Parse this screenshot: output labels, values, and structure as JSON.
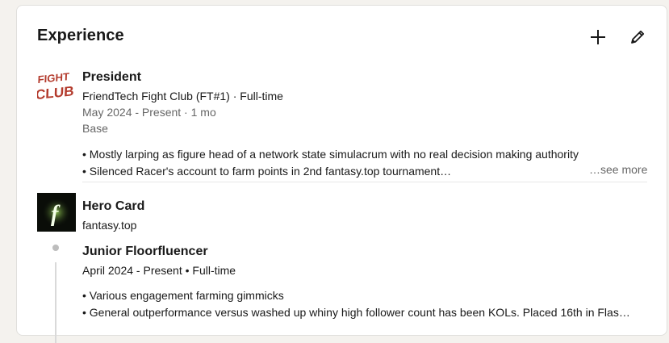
{
  "section": {
    "title": "Experience",
    "add_icon": "plus-icon",
    "edit_icon": "pencil-icon"
  },
  "entries": [
    {
      "logo": "fight-club-logo",
      "logo_text": [
        "FIGHT",
        "CLUB"
      ],
      "title": "President",
      "company_line": "FriendTech Fight Club (FT#1) · Full-time",
      "dates": "May 2024 - Present · 1 mo",
      "location": "Base",
      "bullets": [
        "• Mostly larping as figure head of a network state simulacrum with no real decision making authority",
        "• Silenced Racer's account to farm points in 2nd fantasy.top tournament…"
      ],
      "see_more": "…see more"
    },
    {
      "logo": "fantasy-top-logo",
      "logo_text": "f",
      "company": "Hero Card",
      "company_sub": "fantasy.top",
      "roles": [
        {
          "title": "Junior Floorfluencer",
          "dates": "April 2024 - Present • Full-time",
          "bullets": [
            "• Various engagement farming gimmicks",
            "• General outperformance versus washed up whiny high follower count has been KOLs. Placed 16th in Flas…"
          ]
        }
      ]
    }
  ],
  "colors": {
    "background": "#f4f2ee",
    "card": "#ffffff",
    "text": "#191919",
    "muted": "#666666",
    "fight_club_red": "#b33a2c",
    "fantasy_green": "#8ef04a"
  }
}
